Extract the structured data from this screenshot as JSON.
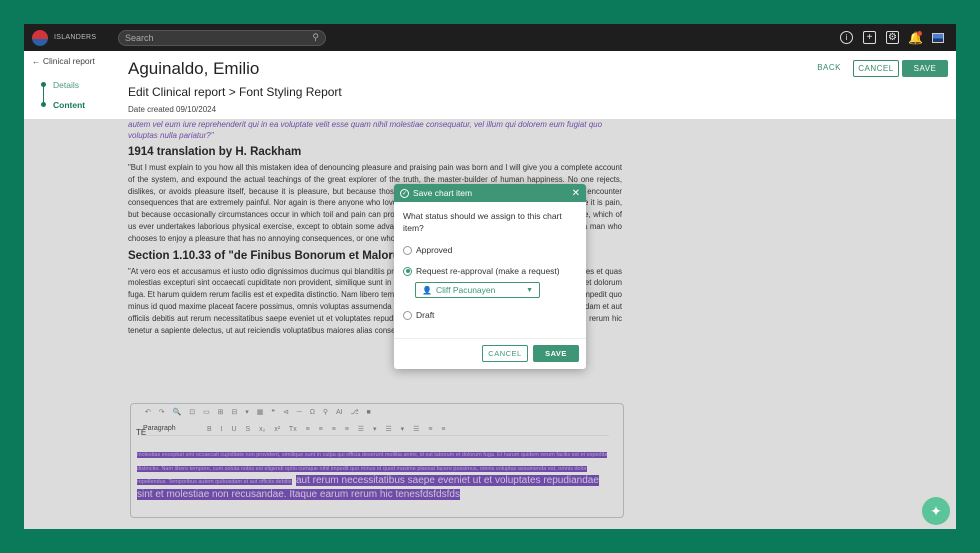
{
  "app": {
    "brand": "ISLANDERS"
  },
  "search": {
    "placeholder": "Search"
  },
  "nav": {
    "back_label": "Clinical report",
    "items": [
      {
        "label": "Details",
        "active": false
      },
      {
        "label": "Content",
        "active": true
      }
    ]
  },
  "header": {
    "patient_name": "Aguinaldo, Emilio",
    "breadcrumb": "Edit Clinical report > Font Styling Report",
    "date_created": "Date created 09/10/2024",
    "back_label": "BACK",
    "cancel_label": "CANCEL",
    "save_label": "SAVE"
  },
  "content": {
    "purple_text": "autem vel eum iure reprehenderit qui in ea voluptate velit esse quam nihil molestiae consequatur, vel illum qui dolorem eum fugiat quo voluptas nulla pariatur?\"",
    "heading1": "1914 translation by H. Rackham",
    "para1": "\"But I must explain to you how all this mistaken idea of denouncing pleasure and praising pain was born and I will give you a complete account of the system, and expound the actual teachings of the great explorer of the truth, the master-builder of human happiness. No one rejects, dislikes, or avoids pleasure itself, because it is pleasure, but because those who do not know how to pursue pleasure rationally encounter consequences that are extremely painful. Nor again is there anyone who loves or pursues or desires to obtain pain of itself, because it is pain, but because occasionally circumstances occur in which toil and pain can procure him some great pleasure. To take a trivial example, which of us ever undertakes laborious physical exercise, except to obtain some advantage from it? But who has any right to find fault with a man who chooses to enjoy a pleasure that has no annoying consequences, or one who avoids a pain that produces no resultant pleasure?\"",
    "heading2": "Section 1.10.33 of \"de Finibus Bonorum et Malorum\", written by Cicero in 45 BC",
    "para2": "\"At vero eos et accusamus et iusto odio dignissimos ducimus qui blanditiis praesentium voluptatum deleniti atque corrupti quos dolores et quas molestias excepturi sint occaecati cupiditate non provident, similique sunt in culpa qui officia deserunt mollitia animi, id est laborum et dolorum fuga. Et harum quidem rerum facilis est et expedita distinctio. Nam libero tempore, cum soluta nobis est eligendi optio cumque nihil impedit quo minus id quod maxime placeat facere possimus, omnis voluptas assumenda est, omnis dolor repellendus. Temporibus autem quibusdam et aut officiis debitis aut rerum necessitatibus saepe eveniet ut et voluptates repudiandae sint et molestiae non recusandae. Itaque earum rerum hic tenetur a sapiente delectus, ut aut reiciendis voluptatibus maiores alias consequatur aut perferendis doloribus asperiores repellat.\""
  },
  "editor": {
    "label": "TE",
    "toolbar_row1": "↶ ↷ 🔍 ⊡ ▭ ⊞ ⊟ ▾ ▦ ❝ ⊲ ─ Ω ⚲ AI ⎇ ■",
    "paragraph_label": "Paragraph",
    "toolbar_row2": "B I U S x₂ x² Tx ≡ ≡ ≡ ≡ ☰ ▾ ☰ ▾ ☰ ≡ ≡",
    "selected_small": "molestias excepturi sint occaecati cupiditate non provident, similique sunt in culpa qui officia deserunt mollitia animi, id est laborum et dolorum fuga. Et harum quidem rerum facilis est et expedita distinctio. Nam libero tempore, cum soluta nobis est eligendi optio cumque nihil impedit quo minus id quod maxime placeat facere possimus, omnis voluptas assumenda est, omnis dolor repellendus. Temporibus autem quibusdam et aut officiis debitis",
    "selected_large": "aut rerum necessitatibus saepe eveniet ut et voluptates repudiandae sint et molestiae non recusandae. Itaque earum rerum hic tenesfdsfdsfds"
  },
  "modal": {
    "title": "Save chart item",
    "question": "What status should we assign to this chart item?",
    "options": [
      {
        "label": "Approved",
        "selected": false
      },
      {
        "label": "Request re-approval (make a request)",
        "selected": true
      },
      {
        "label": "Draft",
        "selected": false
      }
    ],
    "assignee": "Cliff Pacunayen",
    "cancel_label": "CANCEL",
    "save_label": "SAVE"
  },
  "colors": {
    "accent": "#3f9677",
    "frame": "#0a7a5a",
    "topbar": "#1e1e1e",
    "highlight": "#7a4fc0"
  }
}
